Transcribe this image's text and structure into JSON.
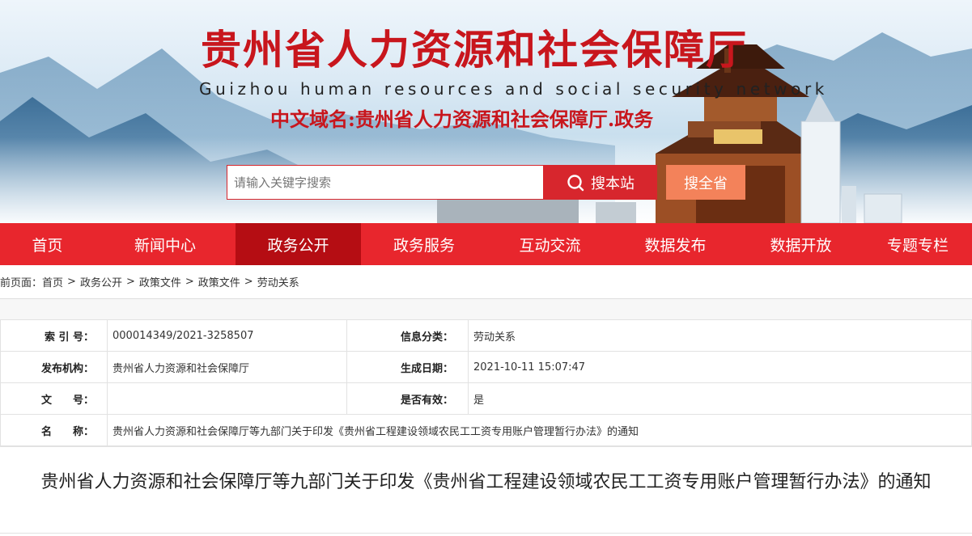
{
  "header": {
    "title": "贵州省人力资源和社会保障厅",
    "subtitle": "Guizhou human resources and social security network",
    "domain": "中文域名:贵州省人力资源和社会保障厅.政务",
    "search": {
      "placeholder": "请输入关键字搜索",
      "value": "",
      "site_button": "搜本站",
      "province_button": "搜全省"
    }
  },
  "nav": {
    "items": [
      {
        "label": "首页"
      },
      {
        "label": "新闻中心"
      },
      {
        "label": "政务公开"
      },
      {
        "label": "政务服务"
      },
      {
        "label": "互动交流"
      },
      {
        "label": "数据发布"
      },
      {
        "label": "数据开放"
      },
      {
        "label": "专题专栏"
      }
    ],
    "active": "政务公开"
  },
  "breadcrumb": {
    "prefix": "前页面：",
    "items": [
      "首页",
      "政务公开",
      "政策文件",
      "政策文件",
      "劳动关系"
    ],
    "separator": ">"
  },
  "info": {
    "index_label": "索 引 号：",
    "index_value": "000014349/2021-3258507",
    "category_label": "信息分类：",
    "category_value": "劳动关系",
    "publisher_label": "发布机构：",
    "publisher_value": "贵州省人力资源和社会保障厅",
    "date_label": "生成日期：",
    "date_value": "2021-10-11 15:07:47",
    "docno_label": "文　　号：",
    "docno_value": "",
    "valid_label": "是否有效：",
    "valid_value": "是",
    "name_label": "名　　称：",
    "name_value": "贵州省人力资源和社会保障厅等九部门关于印发《贵州省工程建设领域农民工工资专用账户管理暂行办法》的通知"
  },
  "article": {
    "title": "贵州省人力资源和社会保障厅等九部门关于印发《贵州省工程建设领域农民工工资专用账户管理暂行办法》的通知"
  },
  "colors": {
    "brand_red": "#e8262d",
    "nav_active": "#b50d13",
    "search_site": "#d7262d",
    "search_province": "#f3825a"
  }
}
